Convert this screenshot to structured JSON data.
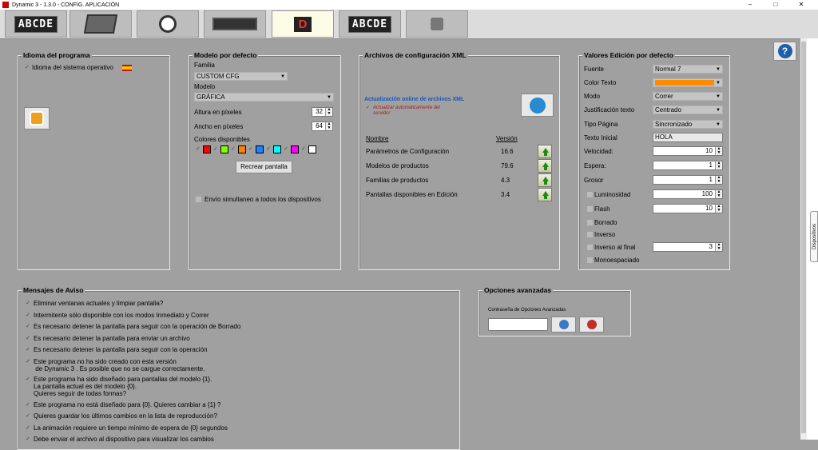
{
  "window": {
    "title": "Dynamic 3 - 1.3.0 - CONFIG. APLICACIÓN",
    "minimize": "–",
    "maximize": "□",
    "close": "✕"
  },
  "toolbar": {
    "tab1_text": "ABCDE",
    "tab3_text": "",
    "tab5_text": "D",
    "tab6_text": "ABCDE"
  },
  "idioma": {
    "title": "Idioma del programa",
    "check": "✓",
    "label": "Idioma del sistema operativo"
  },
  "modelo": {
    "title": "Modelo por defecto",
    "familia_label": "Familia",
    "familia_value": "CUSTOM CFG",
    "modelo_label": "Modelo",
    "modelo_value": "GRÁFICA",
    "alto_label": "Altura en píxeles",
    "alto_value": "32",
    "ancho_label": "Ancho en píxeles",
    "ancho_value": "64",
    "colores_label": "Colores disponibles",
    "recrear": "Recrear pantalla",
    "envio": "Envío simultaneo a todos los dispositivos"
  },
  "colors": [
    "#ff0000",
    "#80ff00",
    "#ff8000",
    "#2080ff",
    "#00ffff",
    "#ff00ff",
    "#ffffff"
  ],
  "xml": {
    "title": "Archivos de configuración XML",
    "online": "Actualización online de archivos XML",
    "auto": "Actualizar automáticamente del servidor",
    "col_nombre": "Nombre",
    "col_version": "Versión",
    "rows": [
      {
        "name": "Parámetros de Configuración",
        "version": "16.6"
      },
      {
        "name": "Modelos de productos",
        "version": "79.6"
      },
      {
        "name": "Familias de productos",
        "version": "4.3"
      },
      {
        "name": "Pantallas disponibles en Edición",
        "version": "3.4"
      }
    ]
  },
  "valores": {
    "title": "Valores Edición por defecto",
    "fuente_label": "Fuente",
    "fuente_value": "Normal 7",
    "color_label": "Color Texto",
    "color_value": "#ff8c00",
    "modo_label": "Modo",
    "modo_value": "Correr",
    "just_label": "Justificación texto",
    "just_value": "Centrado",
    "tipo_label": "Tipo Página",
    "tipo_value": "Sincronizado",
    "texto_label": "Texto Inicial",
    "texto_value": "HOLA",
    "vel_label": "Velocidad:",
    "vel_value": "10",
    "espera_label": "Espera:",
    "espera_value": "1",
    "grosor_label": "Grosor",
    "grosor_value": "1",
    "lum_label": "Luminosidad",
    "lum_value": "100",
    "flash_label": "Flash",
    "flash_value": "10",
    "borrado_label": "Borrado",
    "inverso_label": "Inverso",
    "invfinal_label": "Inverso al final",
    "invfinal_value": "3",
    "mono_label": "Monoespaciado"
  },
  "mensajes": {
    "title": "Mensajes de Aviso",
    "items": [
      "Eliminar ventanas actuales y limpiar pantalla?",
      "Intermitente sólo disponible con los modos Inmediato y Correr",
      "Es necesario detener la pantalla para seguir con la operación de Borrado",
      "Es necesario detener la pantalla para enviar un archivo",
      "Es necesario detener la pantalla para seguir con la operación",
      "Este programa no ha sido creado con esta versión\n de Dynamic 3 . Es posible que no se cargue correctamente.",
      "Este programa ha sido diseñado para pantallas del modelo {1}.\nLa pantalla actual es del modelo {0}.\nQuieres seguir de todas formas?",
      "Este programa no está diseñado para {0}. Quieres cambiar a {1} ?",
      "Quieres guardar los últimos cambios en la lista de reproducción?",
      "La animación requiere un tiempo mínimo de espera de {0} segundos",
      "Debe enviar el archivo al dispositivo para visualizar los cambios"
    ]
  },
  "avanzadas": {
    "title": "Opciones avanzadas",
    "pwd_label": "Contraseña de Opciones Avanzadas",
    "pwd_value": ""
  },
  "help": "?",
  "side_tab": "Dispositivos"
}
